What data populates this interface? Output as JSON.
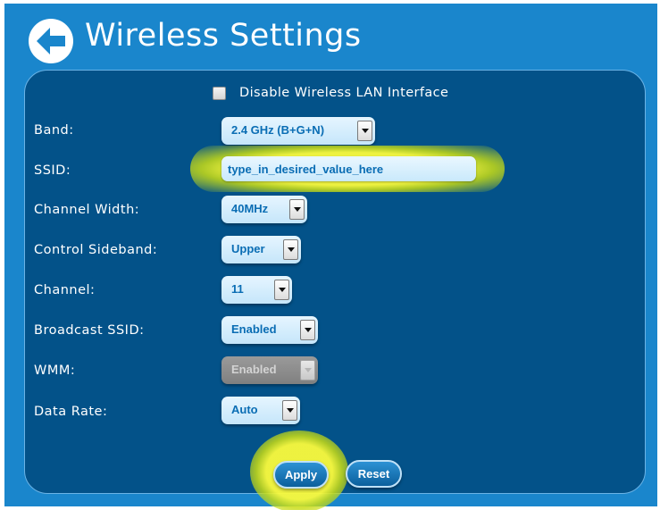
{
  "header": {
    "title": "Wireless Settings",
    "back_icon": "back-arrow-icon"
  },
  "disable_wlan": {
    "label": "Disable Wireless LAN Interface",
    "checked": false
  },
  "fields": {
    "band": {
      "label": "Band:",
      "value": "2.4 GHz (B+G+N)"
    },
    "ssid": {
      "label": "SSID:",
      "value": "type_in_desired_value_here"
    },
    "channel_width": {
      "label": "Channel Width:",
      "value": "40MHz"
    },
    "control_sideband": {
      "label": "Control Sideband:",
      "value": "Upper"
    },
    "channel": {
      "label": "Channel:",
      "value": "11"
    },
    "broadcast_ssid": {
      "label": "Broadcast SSID:",
      "value": "Enabled"
    },
    "wmm": {
      "label": "WMM:",
      "value": "Enabled",
      "disabled": true
    },
    "data_rate": {
      "label": "Data Rate:",
      "value": "Auto"
    }
  },
  "buttons": {
    "apply": "Apply",
    "reset": "Reset"
  },
  "highlights": {
    "color": "#f5f53a",
    "targets": [
      "ssid-input",
      "apply-button"
    ]
  },
  "colors": {
    "header_bg": "#1a86cc",
    "panel_bg": "#035289",
    "field_text": "#0a6db4",
    "label_text": "#ffffff"
  }
}
